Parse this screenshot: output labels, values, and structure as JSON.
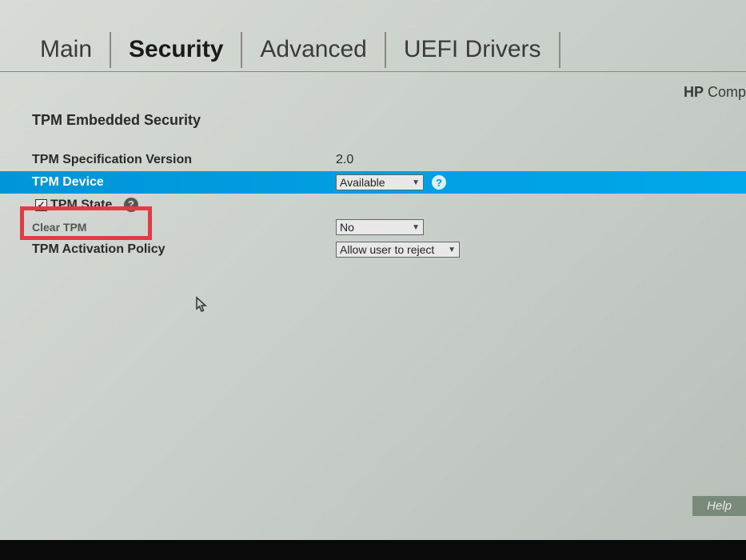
{
  "tabs": {
    "main": "Main",
    "security": "Security",
    "advanced": "Advanced",
    "uefi": "UEFI Drivers"
  },
  "brand_prefix": "HP",
  "brand_suffix": " Comp",
  "section_title": "TPM Embedded Security",
  "settings": {
    "tpm_spec_version": {
      "label": "TPM Specification Version",
      "value": "2.0"
    },
    "tpm_device": {
      "label": "TPM Device",
      "value": "Available"
    },
    "tpm_state": {
      "label": "TPM State"
    },
    "clear_tpm": {
      "label": "Clear TPM",
      "value": "No"
    },
    "tpm_activation_policy": {
      "label": "TPM Activation Policy",
      "value": "Allow user to reject"
    }
  },
  "help_button": "Help",
  "checkbox_check": "✓",
  "help_symbol": "?"
}
